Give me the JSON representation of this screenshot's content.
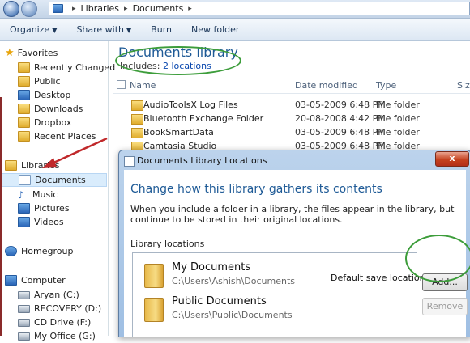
{
  "address": {
    "crumbs": [
      "Libraries",
      "Documents"
    ],
    "separator": "▸"
  },
  "toolbar": {
    "organize": "Organize",
    "share_with": "Share with",
    "burn": "Burn",
    "new_folder": "New folder"
  },
  "nav": {
    "favorites_header": "Favorites",
    "favorites": [
      "Recently Changed",
      "Public",
      "Desktop",
      "Downloads",
      "Dropbox",
      "Recent Places"
    ],
    "libraries_header": "Libraries",
    "libraries": [
      "Documents",
      "Music",
      "Pictures",
      "Videos"
    ],
    "homegroup": "Homegroup",
    "computer_header": "Computer",
    "drives": [
      "Aryan (C:)",
      "RECOVERY (D:)",
      "CD Drive (F:)",
      "My Office (G:)"
    ]
  },
  "library": {
    "title": "Documents library",
    "includes_label": "Includes:",
    "includes_link": "2 locations"
  },
  "columns": {
    "name": "Name",
    "date": "Date modified",
    "type": "Type",
    "size": "Size"
  },
  "files": [
    {
      "name": "AudioToolsX Log Files",
      "date": "03-05-2009 6:48 PM",
      "type": "File folder"
    },
    {
      "name": "Bluetooth Exchange Folder",
      "date": "20-08-2008 4:42 PM",
      "type": "File folder"
    },
    {
      "name": "BookSmartData",
      "date": "03-05-2009 6:48 PM",
      "type": "File folder"
    },
    {
      "name": "Camtasia Studio",
      "date": "03-05-2009 6:48 PM",
      "type": "File folder"
    }
  ],
  "dialog": {
    "title": "Documents Library Locations",
    "close": "x",
    "heading": "Change how this library gathers its contents",
    "description": "When you include a folder in a library, the files appear in the library, but continue to be stored in their original locations.",
    "locations_label": "Library locations",
    "locations": [
      {
        "name": "My Documents",
        "path": "C:\\Users\\Ashish\\Documents",
        "note": "Default save location"
      },
      {
        "name": "Public Documents",
        "path": "C:\\Users\\Public\\Documents",
        "note": ""
      }
    ],
    "add_button": "Add...",
    "remove_button": "Remove"
  },
  "colors": {
    "accent": "#1e5a96",
    "annotation_green": "#3d9d3b",
    "annotation_red": "#c0282a"
  }
}
